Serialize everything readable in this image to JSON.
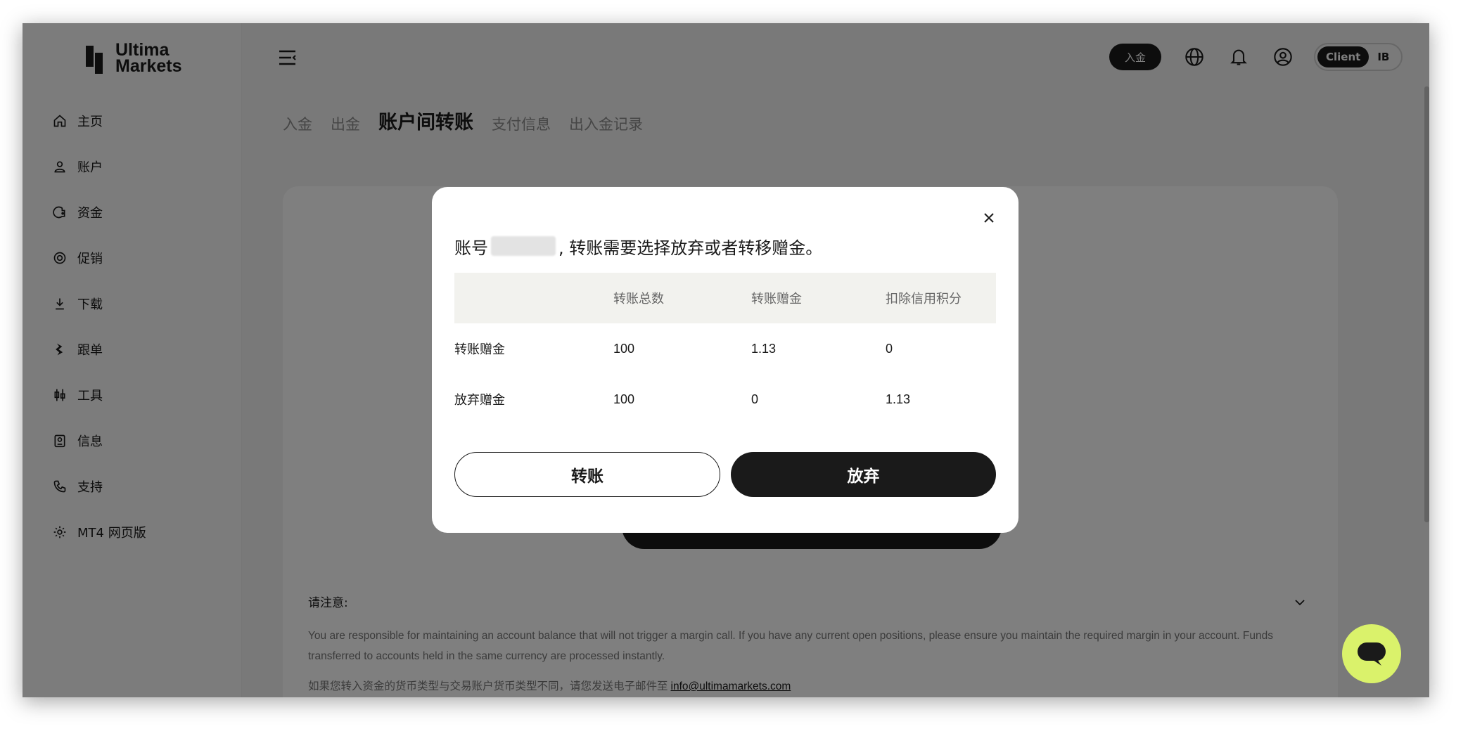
{
  "brand": {
    "name_line1": "Ultima",
    "name_line2": "Markets"
  },
  "sidebar": {
    "items": [
      {
        "label": "主页",
        "icon": "home-icon"
      },
      {
        "label": "账户",
        "icon": "user-icon"
      },
      {
        "label": "资金",
        "icon": "wallet-icon"
      },
      {
        "label": "促销",
        "icon": "target-icon"
      },
      {
        "label": "下载",
        "icon": "download-icon"
      },
      {
        "label": "跟单",
        "icon": "copy-trade-icon"
      },
      {
        "label": "工具",
        "icon": "candlestick-icon"
      },
      {
        "label": "信息",
        "icon": "info-doc-icon"
      },
      {
        "label": "支持",
        "icon": "phone-icon"
      },
      {
        "label": "MT4 网页版",
        "icon": "gear-icon"
      }
    ]
  },
  "header": {
    "deposit_label": "入金",
    "mode_options": [
      "Client",
      "IB"
    ],
    "active_mode": "Client"
  },
  "tabs": [
    {
      "label": "入金",
      "active": false
    },
    {
      "label": "出金",
      "active": false
    },
    {
      "label": "账户间转账",
      "active": true
    },
    {
      "label": "支付信息",
      "active": false
    },
    {
      "label": "出入金记录",
      "active": false
    }
  ],
  "notice": {
    "title": "请注意:",
    "body": "You are responsible for maintaining an account balance that will not trigger a margin call. If you have any current open positions, please ensure you maintain the required margin in your account. Funds transferred to accounts held in the same currency are processed instantly.",
    "cn_text": "如果您转入资金的货币类型与交易账户货币类型不同，请您发送电子邮件至",
    "email": "info@ultimamarkets.com"
  },
  "modal": {
    "prefix": "账号",
    "suffix": ", 转账需要选择放弃或者转移赠金。",
    "columns": [
      "",
      "转账总数",
      "转账赠金",
      "扣除信用积分"
    ],
    "rows": [
      [
        "转账赠金",
        "100",
        "1.13",
        "0"
      ],
      [
        "放弃赠金",
        "100",
        "0",
        "1.13"
      ]
    ],
    "transfer_label": "转账",
    "forfeit_label": "放弃"
  },
  "colors": {
    "accent": "#1a1a1a",
    "chat": "#daf26b",
    "table_header": "#f2f2ee"
  }
}
